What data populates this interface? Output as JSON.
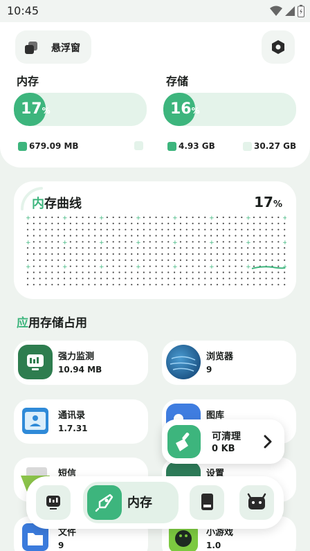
{
  "status_bar": {
    "time": "10:45"
  },
  "header": {
    "float_window_label": "悬浮窗"
  },
  "memory": {
    "title": "内存",
    "percent": "17",
    "percent_sign": "%",
    "fraction": 0.17,
    "used": "679.09 MB",
    "total": ""
  },
  "storage": {
    "title": "存储",
    "percent": "16",
    "percent_sign": "%",
    "fraction": 0.16,
    "used": "4.93 GB",
    "total": "30.27 GB"
  },
  "memory_chart": {
    "title_accent": "内",
    "title_rest": "存曲线",
    "value": "17",
    "value_sign": "%"
  },
  "usage_section": {
    "title_accent": "应",
    "title_rest": "用存储占用"
  },
  "apps": [
    {
      "name": "强力监测",
      "size": "10.94 MB",
      "icon": "monitor-app-icon"
    },
    {
      "name": "浏览器",
      "size": "9",
      "icon": "browser-app-icon"
    },
    {
      "name": "通讯录",
      "size": "1.7.31",
      "icon": "contacts-app-icon"
    },
    {
      "name": "图库",
      "size": "",
      "icon": "gallery-app-icon"
    },
    {
      "name": "短信",
      "size": "",
      "icon": "sms-app-icon"
    },
    {
      "name": "设置",
      "size": "",
      "icon": "settings-app-icon"
    },
    {
      "name": "文件",
      "size": "9",
      "icon": "files-app-icon"
    },
    {
      "name": "小游戏",
      "size": "1.0",
      "icon": "game-app-icon"
    }
  ],
  "cleanable": {
    "label": "可清理",
    "size": "0 KB"
  },
  "nav": {
    "active_label": "内存"
  },
  "colors": {
    "accent": "#3db57d",
    "accent_light": "#e4f3ea",
    "background": "#eef3ef"
  }
}
